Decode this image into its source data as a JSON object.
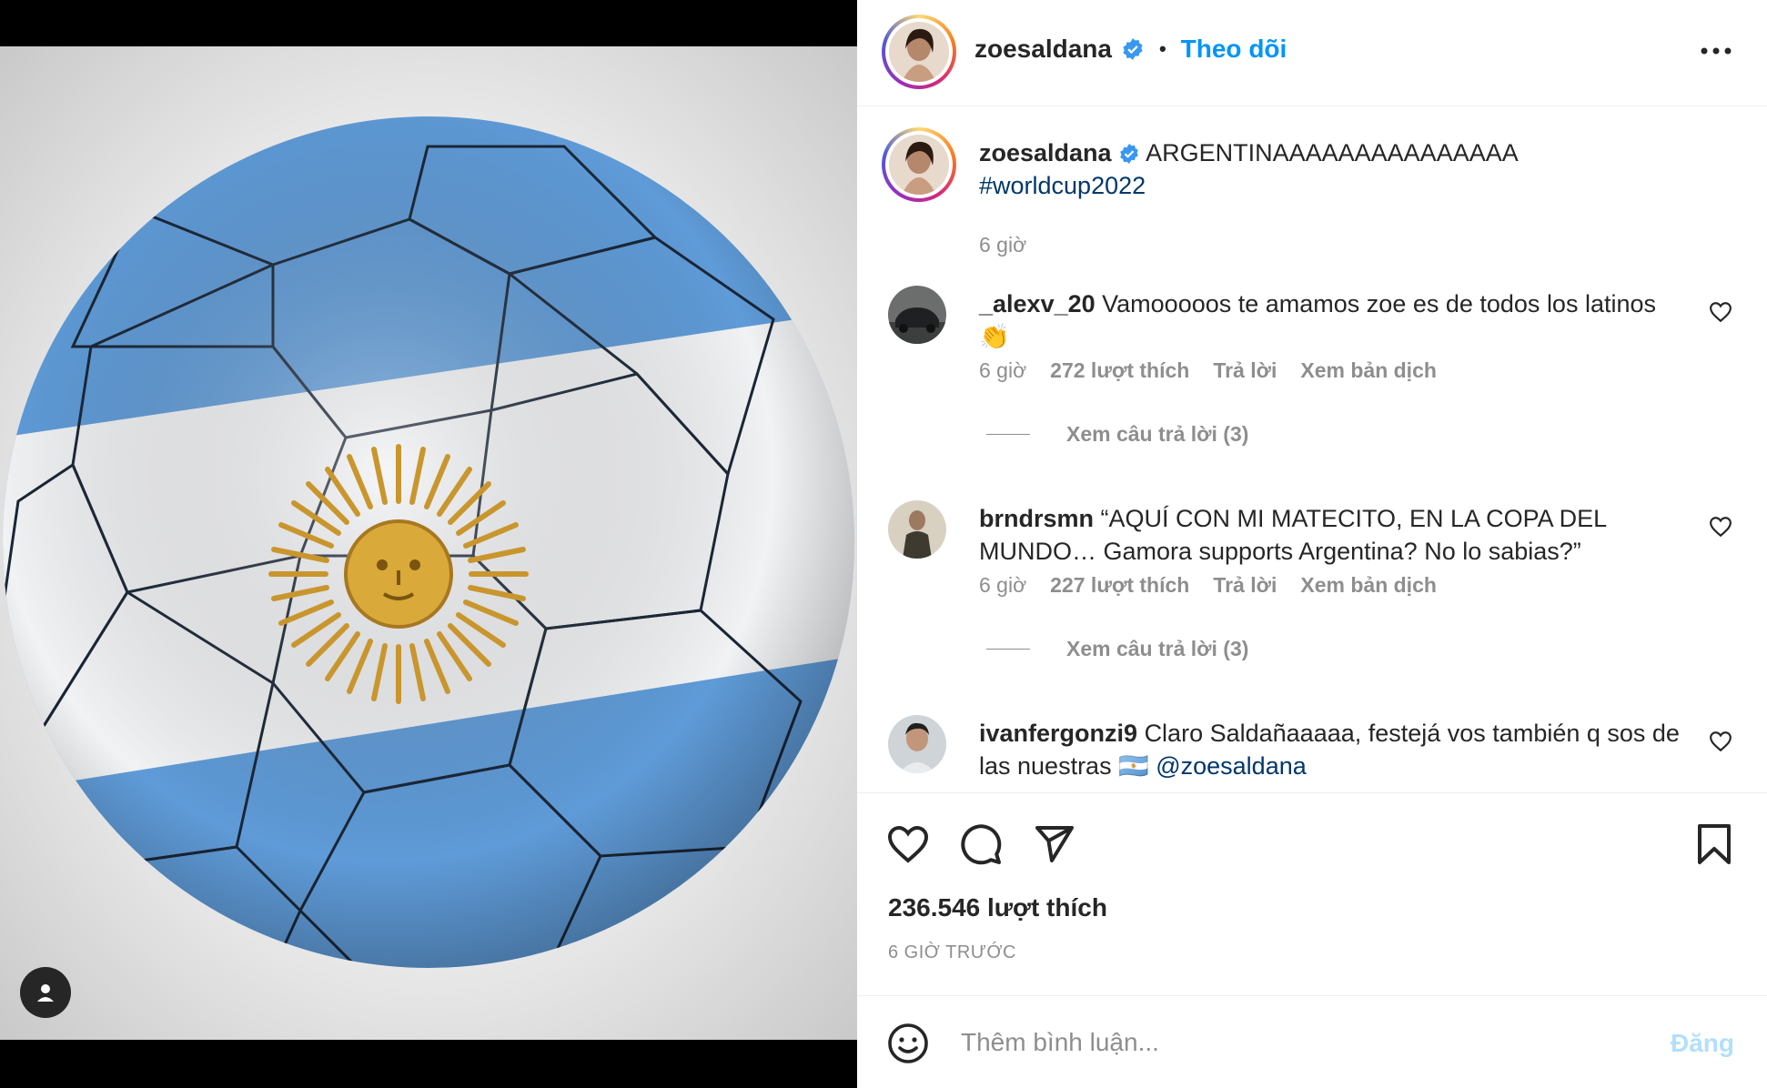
{
  "header": {
    "username": "zoesaldana",
    "separator": "•",
    "follow_label": "Theo dõi",
    "more_icon": "more-horizontal-icon"
  },
  "caption": {
    "username": "zoesaldana",
    "text": "ARGENTINAAAAAAAAAAAAAAA",
    "hashtag": "#worldcup2022",
    "time": "6 giờ"
  },
  "comments": [
    {
      "username": "_alexv_20",
      "text": "Vamooooos te amamos zoe es de todos los latinos 👏",
      "time": "6 giờ",
      "likes": "272 lượt thích",
      "reply_label": "Trả lời",
      "translate_label": "Xem bản dịch",
      "view_replies": "Xem câu trả lời (3)"
    },
    {
      "username": "brndrsmn",
      "text": "“AQUÍ CON MI MATECITO, EN LA COPA DEL MUNDO… Gamora supports Argentina? No lo sabias?”",
      "time": "6 giờ",
      "likes": "227 lượt thích",
      "reply_label": "Trả lời",
      "translate_label": "Xem bản dịch",
      "view_replies": "Xem câu trả lời (3)"
    },
    {
      "username": "ivanfergonzi9",
      "text": "Claro Saldañaaaaa, festejá vos también q sos de las nuestras 🇦🇷",
      "mention": "@zoesaldana"
    }
  ],
  "actions": {
    "like_count": "236.546 lượt thích",
    "time_ago": "6 GIỜ TRƯỚC"
  },
  "add_comment": {
    "placeholder": "Thêm bình luận...",
    "post_label": "Đăng"
  },
  "colors": {
    "accent": "#0095f6",
    "flag_blue": "#6fa8e0",
    "sun_gold": "#c9962e"
  }
}
